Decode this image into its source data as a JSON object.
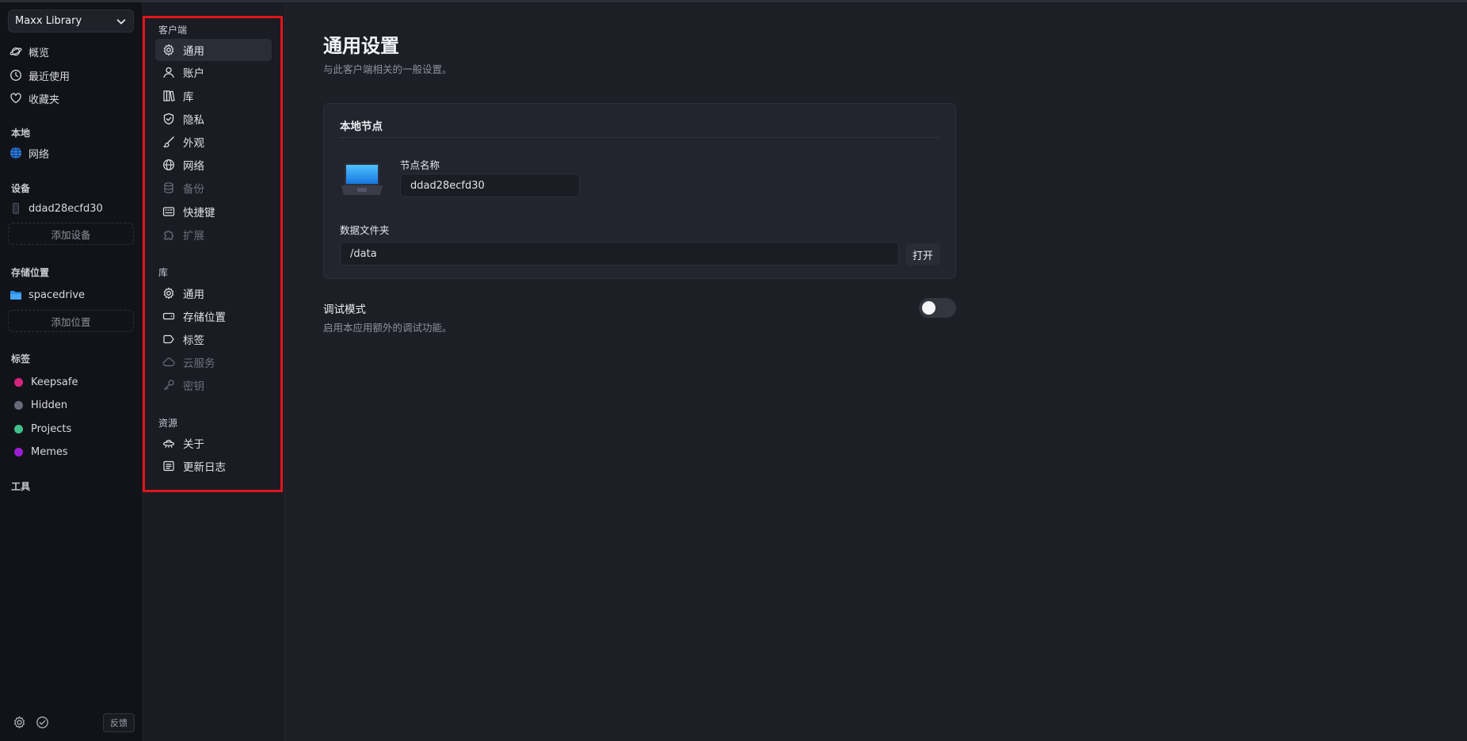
{
  "sidebar": {
    "library_name": "Maxx Library",
    "nav": [
      {
        "label": "概览",
        "icon": "planet-icon"
      },
      {
        "label": "最近使用",
        "icon": "clock-icon"
      },
      {
        "label": "收藏夹",
        "icon": "heart-icon"
      }
    ],
    "local_heading": "本地",
    "local_items": [
      {
        "label": "网络",
        "icon": "globe-icon"
      }
    ],
    "devices_heading": "设备",
    "devices": [
      {
        "label": "ddad28ecfd30",
        "icon": "phone-icon"
      }
    ],
    "add_device": "添加设备",
    "locations_heading": "存储位置",
    "locations": [
      {
        "label": "spacedrive",
        "icon": "folder-icon"
      }
    ],
    "add_location": "添加位置",
    "tags_heading": "标签",
    "tags": [
      {
        "label": "Keepsafe",
        "color": "#d6247d"
      },
      {
        "label": "Hidden",
        "color": "#676a7a"
      },
      {
        "label": "Projects",
        "color": "#3ec08a"
      },
      {
        "label": "Memes",
        "color": "#9b1fd1"
      }
    ],
    "tools_heading": "工具",
    "feedback": "反馈"
  },
  "settings_nav": {
    "client_heading": "客户端",
    "client_items": [
      {
        "label": "通用",
        "icon": "gear-icon",
        "active": true
      },
      {
        "label": "账户",
        "icon": "user-icon"
      },
      {
        "label": "库",
        "icon": "books-icon"
      },
      {
        "label": "隐私",
        "icon": "shield-icon"
      },
      {
        "label": "外观",
        "icon": "paintbrush-icon"
      },
      {
        "label": "网络",
        "icon": "globe-icon"
      },
      {
        "label": "备份",
        "icon": "database-icon",
        "disabled": true
      },
      {
        "label": "快捷键",
        "icon": "keyboard-icon"
      },
      {
        "label": "扩展",
        "icon": "puzzle-icon",
        "disabled": true
      }
    ],
    "library_heading": "库",
    "library_items": [
      {
        "label": "通用",
        "icon": "gear-icon"
      },
      {
        "label": "存储位置",
        "icon": "drive-icon"
      },
      {
        "label": "标签",
        "icon": "tag-icon"
      },
      {
        "label": "云服务",
        "icon": "cloud-icon",
        "disabled": true
      },
      {
        "label": "密钥",
        "icon": "key-icon",
        "disabled": true
      }
    ],
    "resources_heading": "资源",
    "resources_items": [
      {
        "label": "关于",
        "icon": "spaceship-icon"
      },
      {
        "label": "更新日志",
        "icon": "log-icon"
      }
    ]
  },
  "main": {
    "title": "通用设置",
    "subtitle": "与此客户端相关的一般设置。",
    "node_card": {
      "title": "本地节点",
      "node_name_label": "节点名称",
      "node_name_value": "ddad28ecfd30",
      "data_folder_label": "数据文件夹",
      "data_folder_value": "/data",
      "open_button": "打开"
    },
    "debug": {
      "title": "调试模式",
      "description": "启用本应用额外的调试功能。",
      "enabled": false
    }
  }
}
